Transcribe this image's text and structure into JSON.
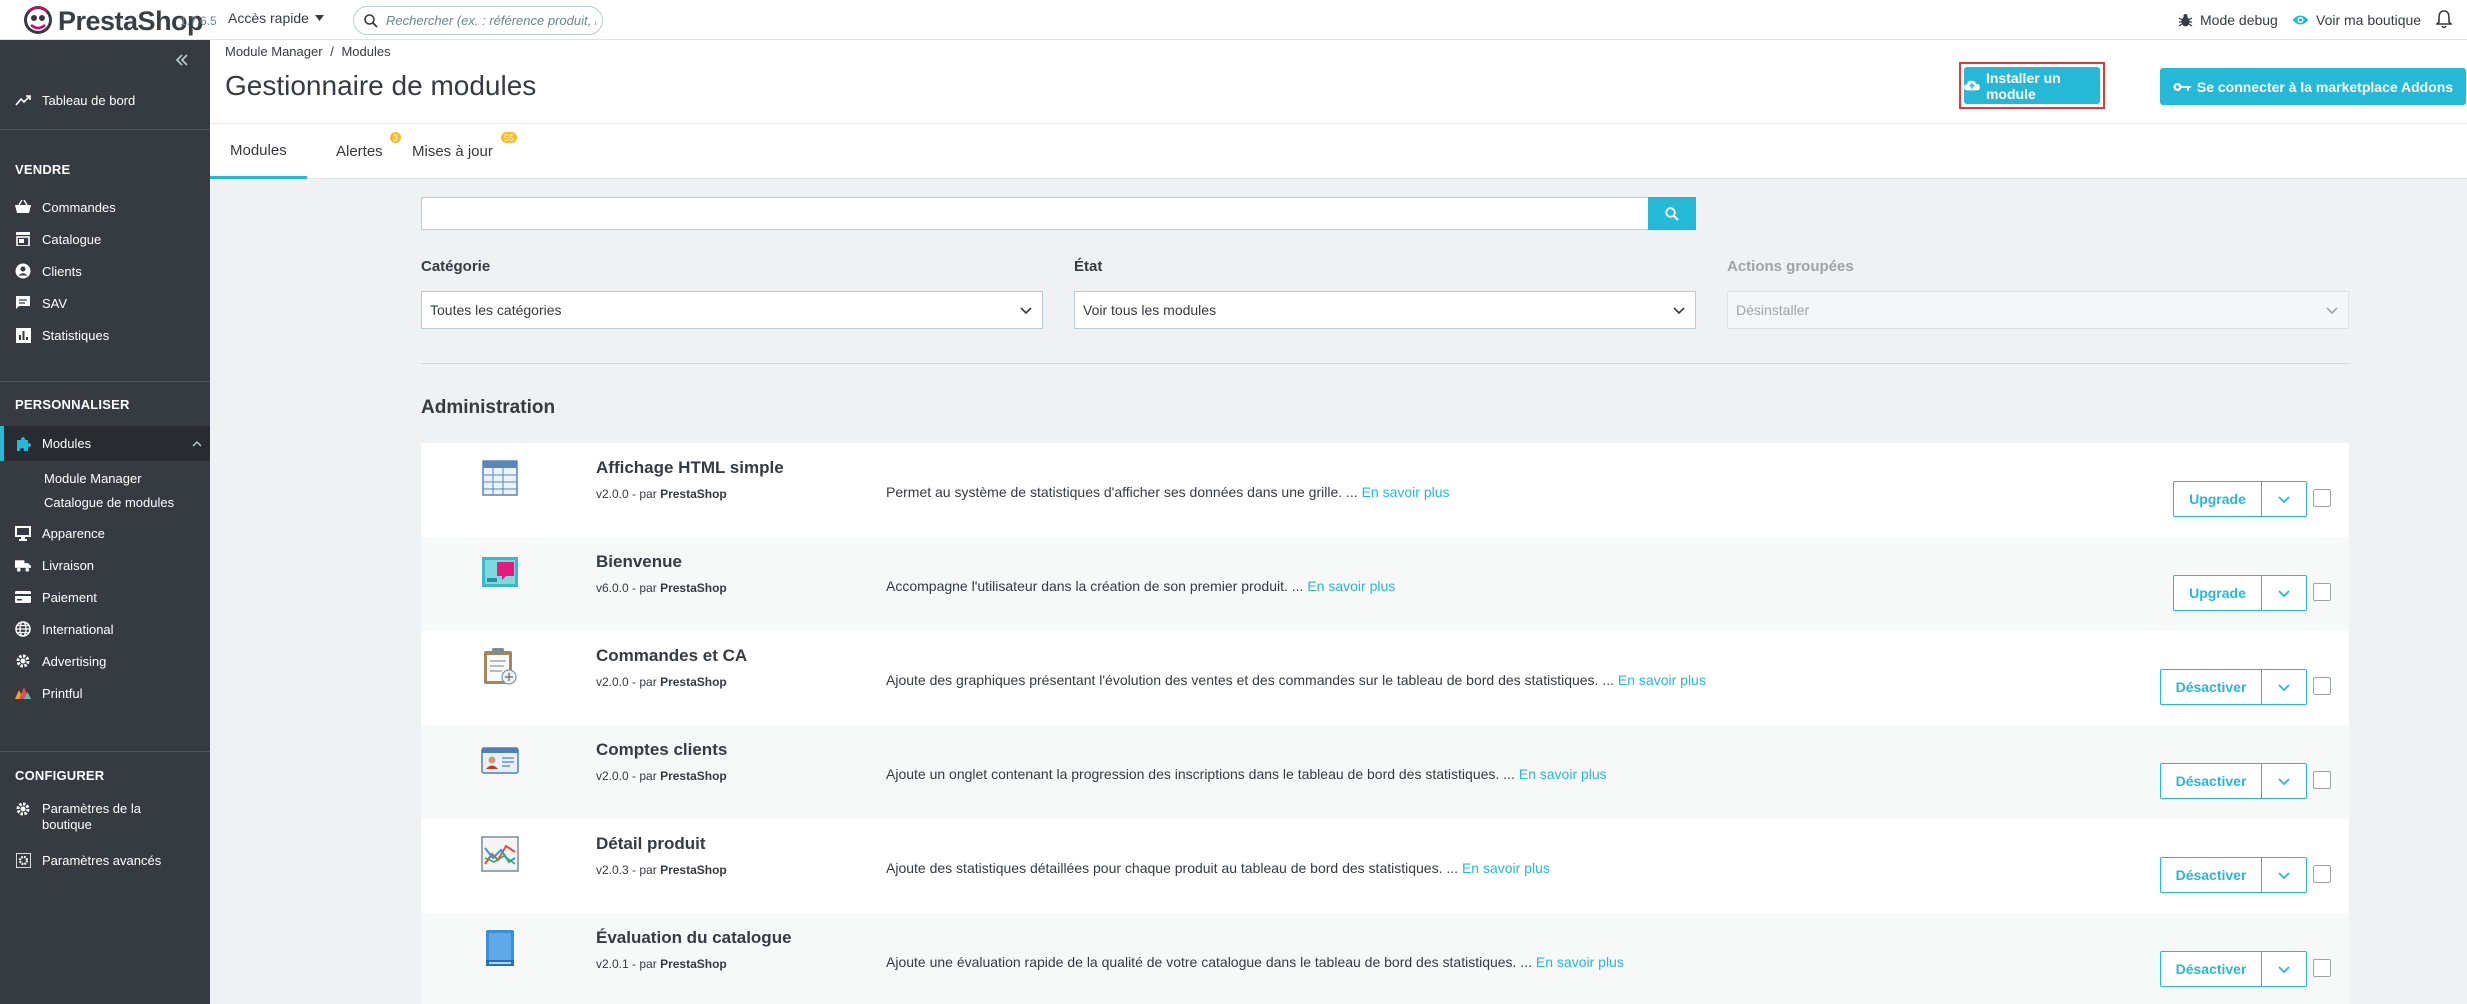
{
  "header": {
    "brand": "PrestaShop",
    "version": "1.7.6.5",
    "quick_access": "Accès rapide",
    "search_placeholder": "Rechercher (ex. : référence produit, nom",
    "debug_mode": "Mode debug",
    "view_shop": "Voir ma boutique"
  },
  "sidebar": {
    "dashboard": "Tableau de bord",
    "sections": {
      "sell": "VENDRE",
      "customize": "PERSONNALISER",
      "configure": "CONFIGURER"
    },
    "sell_items": [
      "Commandes",
      "Catalogue",
      "Clients",
      "SAV",
      "Statistiques"
    ],
    "modules": "Modules",
    "modules_sub": [
      "Module Manager",
      "Catalogue de modules"
    ],
    "customize_items": [
      "Apparence",
      "Livraison",
      "Paiement",
      "International",
      "Advertising",
      "Printful"
    ],
    "configure_items": [
      "Paramètres de la boutique",
      "Paramètres avancés"
    ]
  },
  "page": {
    "breadcrumb": [
      "Module Manager",
      "Modules"
    ],
    "breadcrumb_sep": "/",
    "title": "Gestionnaire de modules",
    "install_button": "Installer un module",
    "addons_button": "Se connecter à la marketplace Addons"
  },
  "tabs": [
    {
      "label": "Modules",
      "badge": ""
    },
    {
      "label": "Alertes",
      "badge": "3"
    },
    {
      "label": "Mises à jour",
      "badge": "55"
    }
  ],
  "filters": {
    "category_label": "Catégorie",
    "category_value": "Toutes les catégories",
    "state_label": "État",
    "state_value": "Voir tous les modules",
    "bulk_label": "Actions groupées",
    "bulk_value": "Désinstaller"
  },
  "section_heading": "Administration",
  "by_label": "par",
  "more_link": "En savoir plus",
  "modules": [
    {
      "name": "Affichage HTML simple",
      "version": "v2.0.0",
      "author": "PrestaShop",
      "description": "Permet au système de statistiques d'afficher ses données dans une grille. ...",
      "action": "Upgrade",
      "icon": "grid-table-icon"
    },
    {
      "name": "Bienvenue",
      "version": "v6.0.0",
      "author": "PrestaShop",
      "description": "Accompagne l'utilisateur dans la création de son premier produit. ...",
      "action": "Upgrade",
      "icon": "welcome-board-icon"
    },
    {
      "name": "Commandes et CA",
      "version": "v2.0.0",
      "author": "PrestaShop",
      "description": "Ajoute des graphiques présentant l'évolution des ventes et des commandes sur le tableau de bord des statistiques. ...",
      "action": "Désactiver",
      "icon": "clipboard-icon"
    },
    {
      "name": "Comptes clients",
      "version": "v2.0.0",
      "author": "PrestaShop",
      "description": "Ajoute un onglet contenant la progression des inscriptions dans le tableau de bord des statistiques. ...",
      "action": "Désactiver",
      "icon": "id-card-icon"
    },
    {
      "name": "Détail produit",
      "version": "v2.0.3",
      "author": "PrestaShop",
      "description": "Ajoute des statistiques détaillées pour chaque produit au tableau de bord des statistiques. ...",
      "action": "Désactiver",
      "icon": "line-chart-icon"
    },
    {
      "name": "Évaluation du catalogue",
      "version": "v2.0.1",
      "author": "PrestaShop",
      "description": "Ajoute une évaluation rapide de la qualité de votre catalogue dans le tableau de bord des statistiques. ...",
      "action": "Désactiver",
      "icon": "book-icon"
    }
  ],
  "colors": {
    "accent": "#25b9d7",
    "sidebar_bg": "#363a41",
    "badge": "#fbbb22",
    "highlight_border": "#e53935"
  }
}
